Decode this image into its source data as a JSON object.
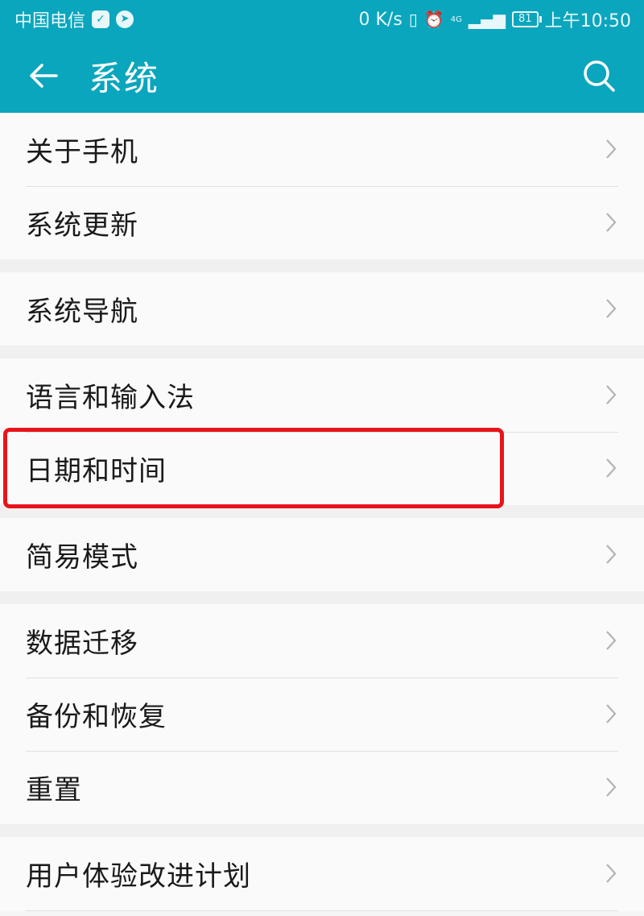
{
  "status_bar": {
    "carrier": "中国电信",
    "speed": "0 K/s",
    "network": "4G",
    "battery": "81",
    "time": "上午10:50"
  },
  "app_bar": {
    "title": "系统"
  },
  "groups": [
    {
      "items": [
        {
          "label": "关于手机"
        },
        {
          "label": "系统更新"
        }
      ]
    },
    {
      "items": [
        {
          "label": "系统导航"
        }
      ]
    },
    {
      "items": [
        {
          "label": "语言和输入法"
        },
        {
          "label": "日期和时间"
        }
      ]
    },
    {
      "items": [
        {
          "label": "简易模式"
        }
      ]
    },
    {
      "items": [
        {
          "label": "数据迁移"
        },
        {
          "label": "备份和恢复"
        },
        {
          "label": "重置"
        }
      ]
    },
    {
      "items": [
        {
          "label": "用户体验改进计划"
        }
      ]
    }
  ],
  "highlighted_item": "日期和时间",
  "colors": {
    "accent": "#0aa6bd",
    "highlight": "#e8141b"
  }
}
